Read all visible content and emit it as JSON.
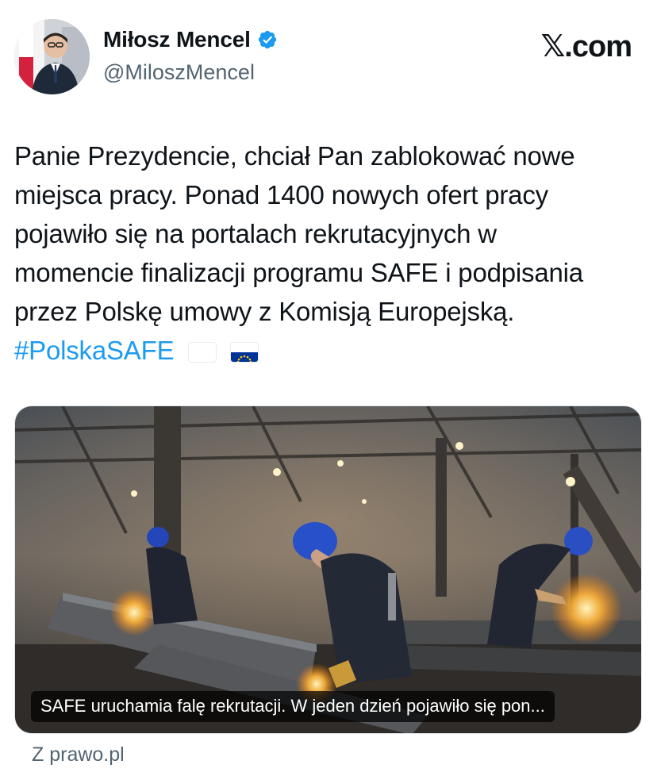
{
  "author": {
    "display_name": "Miłosz Mencel",
    "handle": "@MiloszMencel",
    "verified": true,
    "verified_color": "#1d9bf0",
    "avatar_icon": "profile-photo"
  },
  "site_logo": "𝕏.com",
  "tweet": {
    "lines": [
      "Panie Prezydencie, chciał Pan zablokować nowe",
      "miejsca pracy. Ponad 1400 nowych ofert pracy",
      "pojawiło się na portalach rekrutacyjnych w",
      "momencie finalizacji programu SAFE i podpisania",
      "przez Polskę umowy z Komisją Europejską."
    ],
    "hashtag": "#PolskaSAFE",
    "hashtag_color": "#1d9bf0",
    "emojis": [
      "flag-poland",
      "flag-eu"
    ]
  },
  "link_card": {
    "caption": "SAFE uruchamia falę rekrutacji. W jeden dzień pojawiło się pon...",
    "image_icon": "factory-workers-welding-photo"
  },
  "source": "Z prawo.pl"
}
